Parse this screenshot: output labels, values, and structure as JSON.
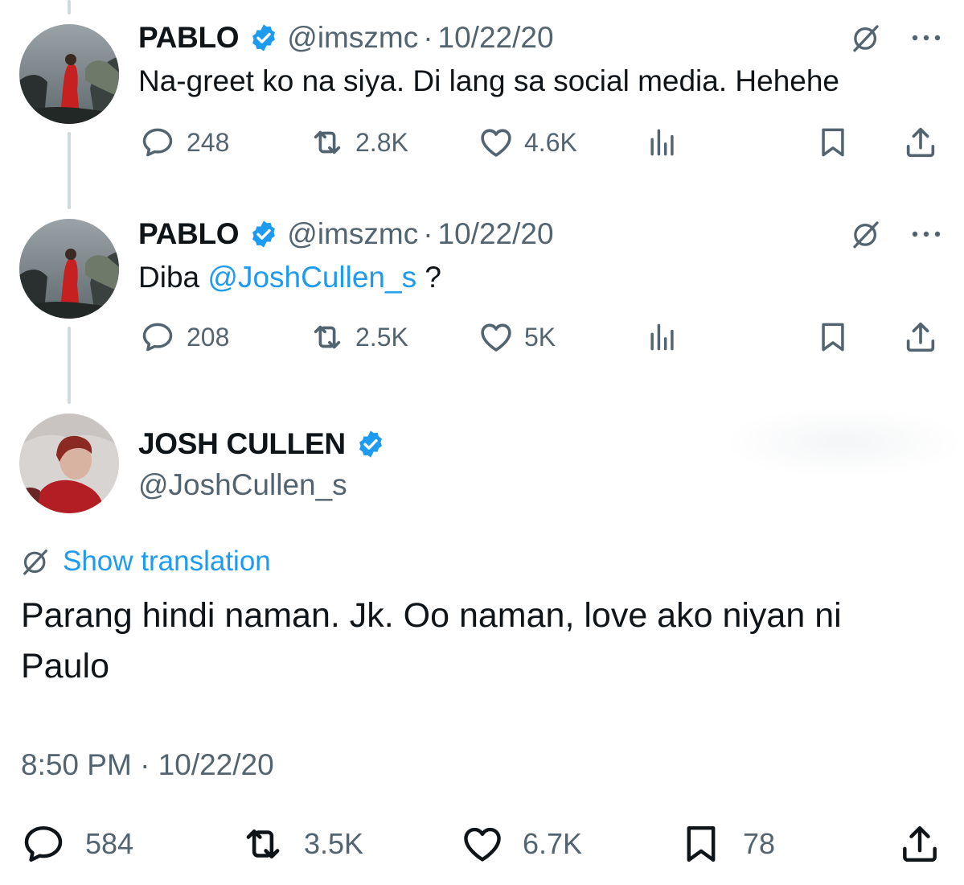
{
  "tweets": [
    {
      "name": "PABLO",
      "handle": "@imszmc",
      "separator": "·",
      "date": "10/22/20",
      "text": "Na-greet ko na siya. Di lang sa social media. Hehehe",
      "replies": "248",
      "retweets": "2.8K",
      "likes": "4.6K"
    },
    {
      "name": "PABLO",
      "handle": "@imszmc",
      "separator": "·",
      "date": "10/22/20",
      "text_prefix": "Diba ",
      "mention": "@JoshCullen_s",
      "text_suffix": " ?",
      "replies": "208",
      "retweets": "2.5K",
      "likes": "5K"
    }
  ],
  "main_tweet": {
    "name": "JOSH CULLEN",
    "handle": "@JoshCullen_s",
    "show_translation": "Show translation",
    "text": "Parang hindi naman. Jk. Oo naman, love ako niyan ni Paulo",
    "timestamp": "8:50 PM · 10/22/20",
    "replies": "584",
    "retweets": "3.5K",
    "likes": "6.7K",
    "bookmarks": "78"
  },
  "icons": {
    "reply": "speech-bubble-icon",
    "retweet": "retweet-arrows-icon",
    "like": "heart-icon",
    "views": "bar-chart-icon",
    "bookmark": "bookmark-icon",
    "share": "share-upload-icon",
    "translate": "grok-slash-circle-icon",
    "more": "more-dots-icon",
    "verified": "verified-badge-icon"
  },
  "colors": {
    "accent": "#1d9bf0",
    "text": "#0f1419",
    "secondary": "#536471",
    "thread_line": "#cfd9de"
  }
}
